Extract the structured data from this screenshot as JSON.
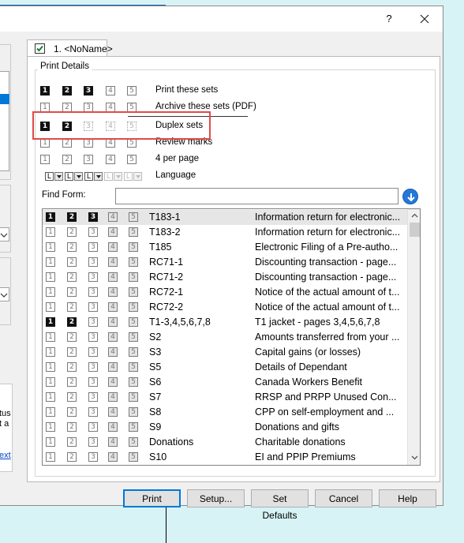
{
  "titlebar": {
    "help_label": "?",
    "close_label": "✕"
  },
  "left_panel": {
    "status_text_1": "tus",
    "status_text_2": "t a",
    "link_text": "ext"
  },
  "tab": {
    "label": "1. <NoName>",
    "checked": true
  },
  "print_details": {
    "group_label": "Print Details",
    "rows": [
      {
        "label": "Print these sets",
        "boxes": [
          "on",
          "on",
          "on",
          "off",
          "off"
        ]
      },
      {
        "label": "Archive these sets (PDF)",
        "boxes": [
          "off",
          "off",
          "off",
          "off",
          "off"
        ]
      },
      {
        "label": "Duplex sets",
        "boxes": [
          "on",
          "on",
          "dis",
          "dis",
          "dis"
        ]
      },
      {
        "label": "Review marks",
        "boxes": [
          "off",
          "off",
          "off",
          "off",
          "off"
        ]
      },
      {
        "label": "4 per page",
        "boxes": [
          "off",
          "off",
          "off",
          "off",
          "off"
        ]
      }
    ],
    "language_label": "Language",
    "language_values": [
      "L",
      "L",
      "L",
      "L",
      "L"
    ],
    "set_numbers": [
      "1",
      "2",
      "3",
      "4",
      "5"
    ]
  },
  "find_form": {
    "label": "Find Form:",
    "value": "",
    "placeholder": ""
  },
  "forms": [
    {
      "code": "T183-1",
      "desc": "Information return for electronic...",
      "boxes": [
        "on",
        "on",
        "on",
        "off",
        "off"
      ],
      "selected": true
    },
    {
      "code": "T183-2",
      "desc": "Information return for electronic...",
      "boxes": [
        "off",
        "off",
        "off",
        "off",
        "off"
      ]
    },
    {
      "code": "T185",
      "desc": "Electronic Filing of a Pre-autho...",
      "boxes": [
        "off",
        "off",
        "off",
        "off",
        "off"
      ]
    },
    {
      "code": "RC71-1",
      "desc": "Discounting transaction - page...",
      "boxes": [
        "off",
        "off",
        "off",
        "off",
        "off"
      ]
    },
    {
      "code": "RC71-2",
      "desc": "Discounting transaction - page...",
      "boxes": [
        "off",
        "off",
        "off",
        "off",
        "off"
      ]
    },
    {
      "code": "RC72-1",
      "desc": "Notice of the actual amount of t...",
      "boxes": [
        "off",
        "off",
        "off",
        "off",
        "off"
      ]
    },
    {
      "code": "RC72-2",
      "desc": "Notice of the actual amount of t...",
      "boxes": [
        "off",
        "off",
        "off",
        "off",
        "off"
      ]
    },
    {
      "code": "T1-3,4,5,6,7,8",
      "desc": "T1 jacket - pages 3,4,5,6,7,8",
      "boxes": [
        "on",
        "on",
        "off",
        "off",
        "off"
      ]
    },
    {
      "code": "S2",
      "desc": "Amounts transferred from your ...",
      "boxes": [
        "off",
        "off",
        "off",
        "off",
        "off"
      ]
    },
    {
      "code": "S3",
      "desc": "Capital gains (or losses)",
      "boxes": [
        "off",
        "off",
        "off",
        "off",
        "off"
      ]
    },
    {
      "code": "S5",
      "desc": "Details of Dependant",
      "boxes": [
        "off",
        "off",
        "off",
        "off",
        "off"
      ]
    },
    {
      "code": "S6",
      "desc": "Canada Workers Benefit",
      "boxes": [
        "off",
        "off",
        "off",
        "off",
        "off"
      ]
    },
    {
      "code": "S7",
      "desc": "RRSP and PRPP Unused Con...",
      "boxes": [
        "off",
        "off",
        "off",
        "off",
        "off"
      ]
    },
    {
      "code": "S8",
      "desc": "CPP on self-employment and ...",
      "boxes": [
        "off",
        "off",
        "off",
        "off",
        "off"
      ]
    },
    {
      "code": "S9",
      "desc": "Donations and gifts",
      "boxes": [
        "off",
        "off",
        "off",
        "off",
        "off"
      ]
    },
    {
      "code": "Donations",
      "desc": "Charitable donations",
      "boxes": [
        "off",
        "off",
        "off",
        "off",
        "off"
      ]
    },
    {
      "code": "S10",
      "desc": "EI and PPIP Premiums",
      "boxes": [
        "off",
        "off",
        "off",
        "off",
        "off"
      ]
    }
  ],
  "buttons": {
    "print": "Print",
    "setup": "Setup...",
    "set_defaults": "Set Defaults",
    "cancel": "Cancel",
    "help": "Help"
  },
  "colors": {
    "highlight": "#e04a4a",
    "accent": "#0078d7",
    "desktop": "#d7f3f5"
  }
}
